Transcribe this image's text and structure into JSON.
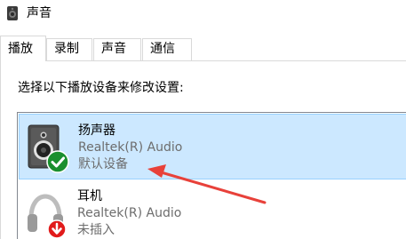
{
  "window": {
    "title": "声音",
    "icon": "speaker-icon"
  },
  "tabs": [
    {
      "label": "播放",
      "active": true
    },
    {
      "label": "录制",
      "active": false
    },
    {
      "label": "声音",
      "active": false
    },
    {
      "label": "通信",
      "active": false
    }
  ],
  "playback": {
    "instruction": "选择以下播放设备来修改设置:",
    "devices": [
      {
        "name": "扬声器",
        "driver": "Realtek(R) Audio",
        "status": "默认设备",
        "icon": "speaker-icon",
        "badge": "green-checkmark-badge",
        "selected": true
      },
      {
        "name": "耳机",
        "driver": "Realtek(R) Audio",
        "status": "未插入",
        "icon": "headphones-icon",
        "badge": "red-down-arrow-badge",
        "selected": false
      }
    ]
  },
  "annotation": {
    "arrow_color": "#e8413a"
  },
  "colors": {
    "selection_bg": "#cce8ff",
    "selection_border": "#99d1ff",
    "default_badge": "#1a8f2e",
    "unplugged_badge": "#e11b1b"
  }
}
